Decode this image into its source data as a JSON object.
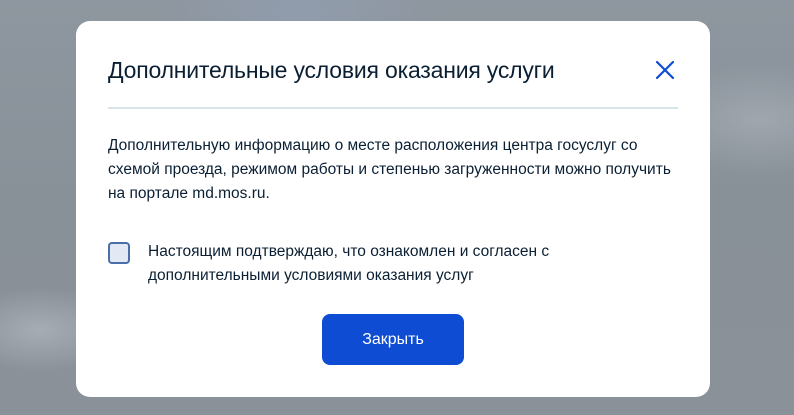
{
  "dialog": {
    "title": "Дополнительные условия оказания услуги",
    "close_icon": "close-icon",
    "info_text": "Дополнительную информацию о месте расположения центра госуслуг со схемой проезда, режимом работы и степенью загруженности можно получить на портале md.mos.ru.",
    "consent": {
      "checked": false,
      "label": "Настоящим подтверждаю, что ознакомлен и согласен с дополнительными условиями оказания услуг"
    },
    "close_button_label": "Закрыть"
  },
  "colors": {
    "primary": "#0d4cd3",
    "text": "#0b1f33",
    "divider": "#d9e3ea",
    "checkbox_border": "#4a6fa8"
  }
}
